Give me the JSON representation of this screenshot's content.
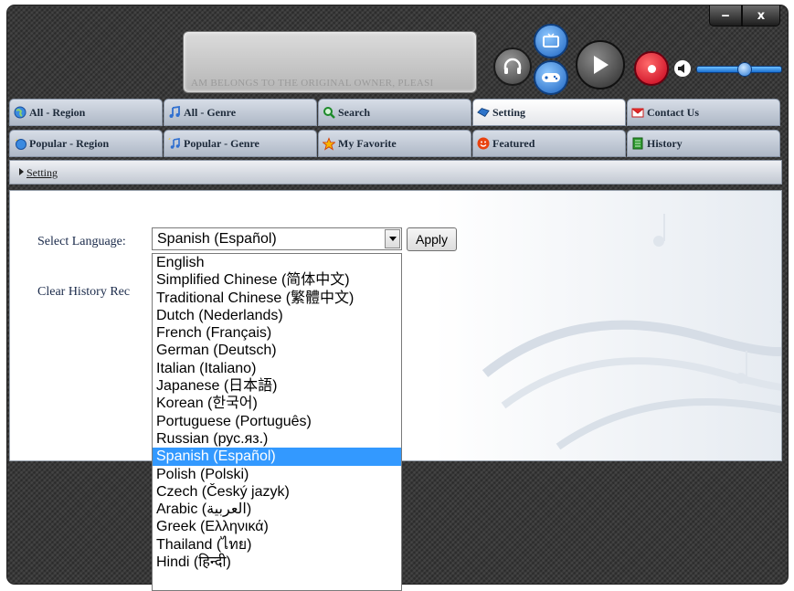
{
  "window": {
    "minimize_glyph": "‒",
    "close_glyph": "x"
  },
  "marquee": {
    "text": "AM BELONGS TO THE ORIGINAL OWNER, PLEASI"
  },
  "player_icons": [
    "headphones-icon",
    "tv-icon",
    "gamepad-icon",
    "play-icon",
    "record-icon",
    "volume-icon",
    "volume-slider"
  ],
  "volume": {
    "level": 0.55
  },
  "tabs_row1": [
    {
      "label": "All - Region",
      "icon": "globe-icon"
    },
    {
      "label": "All - Genre",
      "icon": "music-note-icon"
    },
    {
      "label": "Search",
      "icon": "search-icon"
    },
    {
      "label": "Setting",
      "icon": "setting-icon",
      "active": true
    },
    {
      "label": "Contact Us",
      "icon": "mail-icon"
    }
  ],
  "tabs_row2": [
    {
      "label": "Popular - Region",
      "icon": "globe-star-icon"
    },
    {
      "label": "Popular - Genre",
      "icon": "music-star-icon"
    },
    {
      "label": "My Favorite",
      "icon": "star-icon"
    },
    {
      "label": "Featured",
      "icon": "smiley-icon"
    },
    {
      "label": "History",
      "icon": "book-icon"
    }
  ],
  "breadcrumb": {
    "label": "Setting"
  },
  "settings": {
    "language_label": "Select Language:",
    "selected_language": "Spanish (Español)",
    "apply_label": "Apply",
    "clear_history_label": "Clear History Rec"
  },
  "languages": [
    "English",
    "Simplified Chinese (简体中文)",
    "Traditional Chinese (繁體中文)",
    "Dutch (Nederlands)",
    "French (Français)",
    "German (Deutsch)",
    "Italian (Italiano)",
    "Japanese (日本語)",
    "Korean (한국어)",
    "Portuguese (Português)",
    "Russian (рус.яз.)",
    "Spanish (Español)",
    "Polish (Polski)",
    "Czech (Český jazyk)",
    "Arabic (العربية)",
    "Greek (Ελληνικά)",
    "Thailand (ไทย)",
    "Hindi (हिन्दी)"
  ],
  "selected_index": 11,
  "colors": {
    "selection": "#3399ff",
    "record": "#e0001b"
  }
}
